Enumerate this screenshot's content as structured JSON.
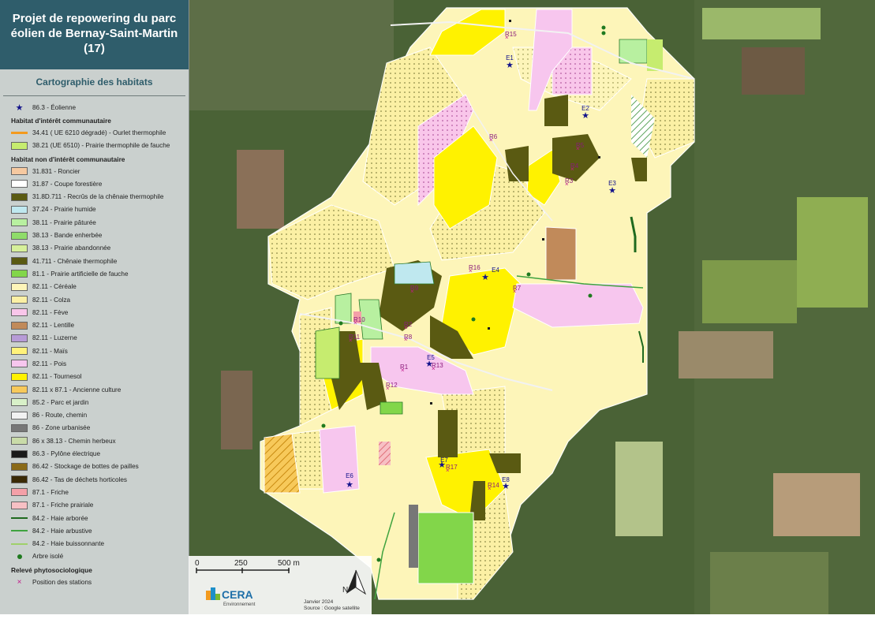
{
  "title": "Projet de repowering du parc éolien de Bernay-Saint-Martin (17)",
  "subtitle": "Cartographie des habitats",
  "legend": {
    "turbine": "86.3 - Éolienne",
    "section_ic": "Habitat d'intérêt communautaire",
    "ic_items": [
      {
        "label": "34.41 ( UE 6210 dégradé) - Ourlet thermophile",
        "color": "#f39a1e"
      },
      {
        "label": "38.21 (UE 6510) - Prairie thermophile de fauche",
        "color": "#c6ec6f"
      }
    ],
    "section_nic": "Habitat non d'intérêt communautaire",
    "nic_items": [
      {
        "label": "31.831 - Roncier",
        "color": "#f6c9a0"
      },
      {
        "label": "31.87 - Coupe forestière",
        "color": "#ffffff"
      },
      {
        "label": "31.8D.711 - Recrûs de la chênaie thermophile",
        "color": "#5a5a12"
      },
      {
        "label": "37.24 - Prairie humide",
        "color": "#bfe8ef"
      },
      {
        "label": "38.11 - Prairie pâturée",
        "color": "#b8f0a0"
      },
      {
        "label": "38.13 - Bande enherbée",
        "color": "#8fdc6a"
      },
      {
        "label": "38.13 - Prairie abandonnée",
        "color": "#d6f09a"
      },
      {
        "label": "41.711 - Chênaie thermophile",
        "color": "#5a5a12"
      },
      {
        "label": "81.1 - Prairie artificielle de fauche",
        "color": "#82d64a"
      },
      {
        "label": "82.11 - Céréale",
        "color": "#fdf5b9"
      },
      {
        "label": "82.11 - Colza",
        "color": "#fbf0a4"
      },
      {
        "label": "82.11 - Fève",
        "color": "#f9c6ea"
      },
      {
        "label": "82.11 - Lentille",
        "color": "#c18a5a"
      },
      {
        "label": "82.11 - Luzerne",
        "color": "#b79bd6"
      },
      {
        "label": "82.11 - Maïs",
        "color": "#fff27a"
      },
      {
        "label": "82.11 - Pois",
        "color": "#f7c6ee"
      },
      {
        "label": "82.11 - Tournesol",
        "color": "#fff200"
      },
      {
        "label": "82.11 x 87.1 - Ancienne culture",
        "color": "#f7c95a"
      },
      {
        "label": "85.2 - Parc et jardin",
        "color": "#d8f0c8"
      },
      {
        "label": "86 - Route, chemin",
        "color": "#f2f2f2"
      },
      {
        "label": "86 - Zone urbanisée",
        "color": "#777777"
      },
      {
        "label": "86 x 38.13 - Chemin herbeux",
        "color": "#c9dba8"
      },
      {
        "label": "86.3 - Pylône électrique",
        "color": "#1a1a1a"
      },
      {
        "label": "86.42 - Stockage de bottes de pailles",
        "color": "#8a6a18"
      },
      {
        "label": "86.42 - Tas de déchets horticoles",
        "color": "#3a2a06"
      },
      {
        "label": "87.1 - Friche",
        "color": "#f4a0a8"
      },
      {
        "label": "87.1 - Friche prairiale",
        "color": "#f7c0c4"
      }
    ],
    "hedges": [
      {
        "label": "84.2 - Haie arborée",
        "color": "#1f6a1f"
      },
      {
        "label": "84.2 - Haie arbustive",
        "color": "#3fa33f"
      },
      {
        "label": "84.2 - Haie buissonnante",
        "color": "#9fd06a"
      }
    ],
    "tree": "Arbre isolé",
    "section_releve": "Relevé phytosociologique",
    "stations": "Position des stations"
  },
  "scale": {
    "t0": "0",
    "t1": "250",
    "t2": "500 m"
  },
  "brand": {
    "name": "CERA",
    "sub": "Environnement"
  },
  "source": {
    "date": "Janvier 2024",
    "text": "Source : Google satellite"
  },
  "north": "N",
  "turbines": [
    "E1",
    "E2",
    "E3",
    "E4",
    "E5",
    "E6",
    "E7",
    "E8"
  ],
  "stations": [
    "R1",
    "R2",
    "R3",
    "R4",
    "R5",
    "R6",
    "R7",
    "R8",
    "R9",
    "R10",
    "R11",
    "R12",
    "R13",
    "R14",
    "R15",
    "R16",
    "R17"
  ]
}
